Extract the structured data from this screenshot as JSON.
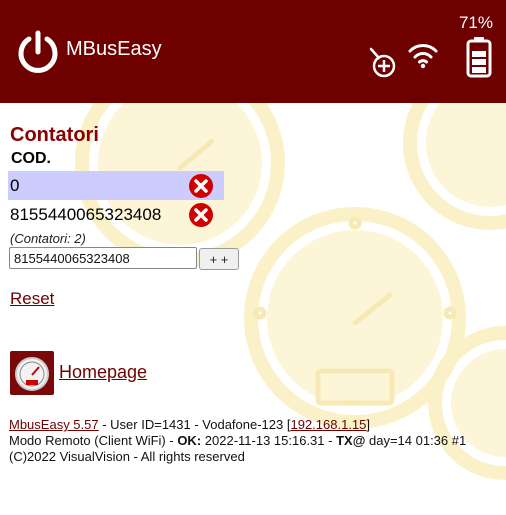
{
  "header": {
    "app_title": "MBusEasy",
    "battery_percent": "71%",
    "icons": [
      "power-icon",
      "meter-add-icon",
      "wifi-icon",
      "battery-icon"
    ],
    "accent_color": "#6e0000"
  },
  "section": {
    "title": "Contatori",
    "column_header": "COD.",
    "rows": [
      {
        "code": "0",
        "selected": true
      },
      {
        "code": "8155440065323408",
        "selected": false
      }
    ],
    "count_note": "(Contatori: 2)",
    "input_value": "8155440065323408",
    "add_button_label": "+ +",
    "reset_label": "Reset"
  },
  "nav": {
    "homepage_label": "Homepage"
  },
  "footer": {
    "version_link": "MbusEasy 5.57",
    "user_text": " - User ID=1431 - Vodafone-123 [",
    "ip_link": "192.168.1.15",
    "ip_close": "]",
    "mode_text": "Modo Remoto (Client WiFi) - ",
    "ok_label": "OK:",
    "ok_time": " 2022-11-13 15:16.31 - ",
    "tx_label": "TX@",
    "tx_text": " day=14 01:36 #1",
    "copyright": "(C)2022 VisualVision - All rights reserved"
  }
}
